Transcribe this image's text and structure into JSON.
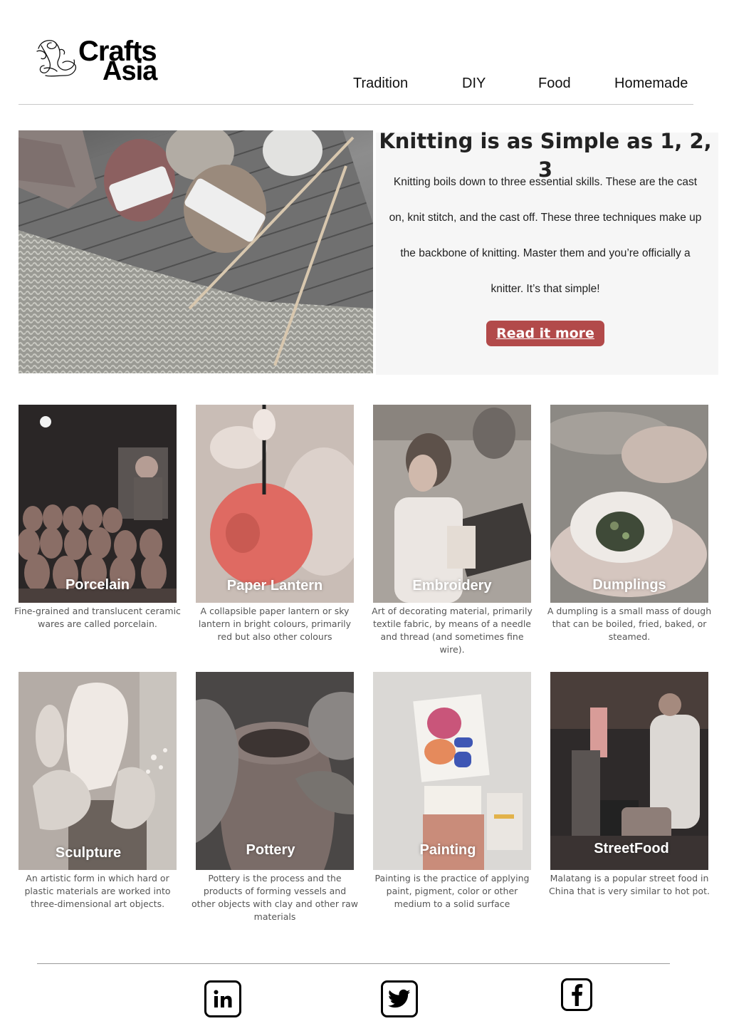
{
  "brand": {
    "name_line1": "Crafts",
    "name_line2": "Asia"
  },
  "nav": {
    "items": [
      "Tradition",
      "DIY",
      "Food",
      "Homemade"
    ]
  },
  "hero": {
    "title": "Knitting is as Simple as 1, 2, 3",
    "text": "Knitting boils down to three essential skills. These are the cast on, knit stitch, and the cast off. These three techniques make up the backbone of knitting. Master them and you’re officially a knitter. It’s that simple!",
    "button_label": "Read it more",
    "button_color": "#b24a4a"
  },
  "cards": [
    {
      "title": "Porcelain",
      "description": "Fine-grained and translucent ceramic wares are called porcelain."
    },
    {
      "title": "Paper Lantern",
      "description": "A collapsible paper lantern or sky lantern in bright colours, primarily red but also other colours"
    },
    {
      "title": "Embroidery",
      "description": "Art of decorating material, primarily textile fabric, by means of a needle and thread (and sometimes fine wire)."
    },
    {
      "title": "Dumplings",
      "description": "A dumpling is a small mass of dough that can be boiled, fried, baked, or steamed."
    },
    {
      "title": "Sculpture",
      "description": "An artistic form in which hard or plastic materials are worked into three-dimensional art objects."
    },
    {
      "title": "Pottery",
      "description": "Pottery is the process and the products of forming vessels and other objects with clay and other raw materials"
    },
    {
      "title": "Painting",
      "description": "Painting is the practice of applying paint, pigment, color or other medium to a solid surface"
    },
    {
      "title": "StreetFood",
      "description": "Malatang is a popular street food in China that is very similar to hot pot."
    }
  ],
  "footer": {
    "social_icons": [
      "linkedin-icon",
      "twitter-icon",
      "facebook-icon"
    ]
  }
}
